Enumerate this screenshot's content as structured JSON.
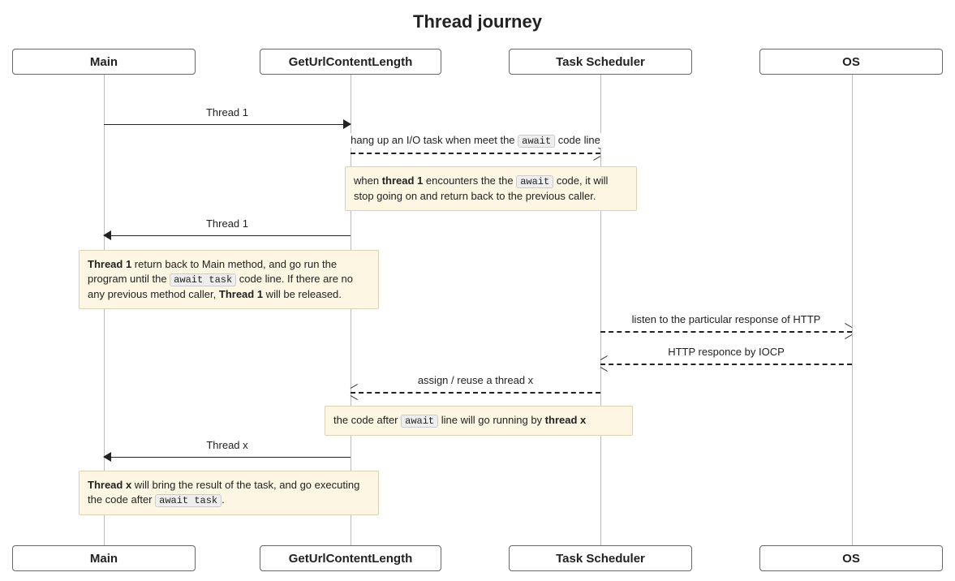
{
  "title": "Thread journey",
  "actors": {
    "main": "Main",
    "getUrl": "GetUrlContentLength",
    "scheduler": "Task Scheduler",
    "os": "OS"
  },
  "messages": {
    "m1": "Thread 1",
    "m2_pre": "hang up an I/O task when meet the ",
    "m2_code": "await",
    "m2_post": " code line",
    "m3": "Thread 1",
    "m4": "listen to the particular response of HTTP",
    "m5": "HTTP responce by IOCP",
    "m6": "assign / reuse a thread x",
    "m7": "Thread x"
  },
  "notes": {
    "n1_pre": "when ",
    "n1_b1": "thread 1",
    "n1_mid": " encounters the the ",
    "n1_code": "await",
    "n1_post": " code, it will stop going on and return back to the previous caller.",
    "n2_b1": "Thread 1",
    "n2_mid1": " return back to Main method, and go run the program until the ",
    "n2_code": "await task",
    "n2_mid2": " code line. If there are no any previous method caller, ",
    "n2_b2": "Thread 1",
    "n2_post": " will be released.",
    "n3_pre": "the code after ",
    "n3_code": "await",
    "n3_mid": " line will go running by ",
    "n3_b": "thread x",
    "n4_b": "Thread x",
    "n4_mid": " will bring the result of the task, and go executing the code after ",
    "n4_code": "await task",
    "n4_post": "."
  }
}
